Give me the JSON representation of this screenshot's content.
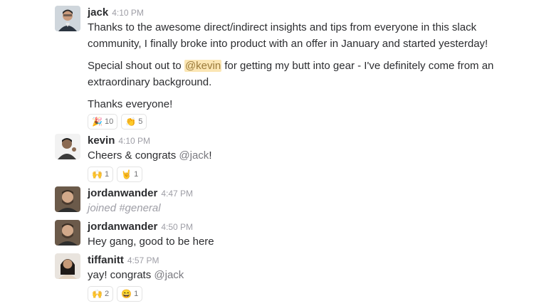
{
  "messages": [
    {
      "user": "jack",
      "time": "4:10 PM",
      "paragraphs": {
        "p1": "Thanks to the awesome direct/indirect insights and tips from everyone in this slack community, I finally broke into product with an offer in January and started yesterday!",
        "p2_pre": "Special shout out to ",
        "p2_mention": "@kevin",
        "p2_post": " for getting my butt into gear - I've definitely come from an extraordinary background.",
        "p3": "Thanks everyone!"
      },
      "reactions": [
        {
          "icon": "party-popper-icon",
          "glyph": "🎉",
          "count": "10"
        },
        {
          "icon": "clapping-hands-icon",
          "glyph": "👏",
          "count": "5"
        }
      ]
    },
    {
      "user": "kevin",
      "time": "4:10 PM",
      "text_pre": "Cheers & congrats ",
      "mention": "@jack",
      "text_post": "!",
      "reactions": [
        {
          "icon": "raised-hands-icon",
          "glyph": "🙌",
          "count": "1"
        },
        {
          "icon": "rock-on-hand-icon",
          "glyph": "🤘",
          "count": "1"
        }
      ]
    },
    {
      "user": "jordanwander",
      "time": "4:47 PM",
      "joined": "joined #general"
    },
    {
      "user": "jordanwander",
      "time": "4:50 PM",
      "text": "Hey gang, good to be here"
    },
    {
      "user": "tiffanitt",
      "time": "4:57 PM",
      "text_pre": "yay! congrats ",
      "mention": "@jack",
      "reactions": [
        {
          "icon": "raised-hands-icon",
          "glyph": "🙌",
          "count": "2"
        },
        {
          "icon": "grinning-face-icon",
          "glyph": "😄",
          "count": "1"
        }
      ]
    }
  ]
}
